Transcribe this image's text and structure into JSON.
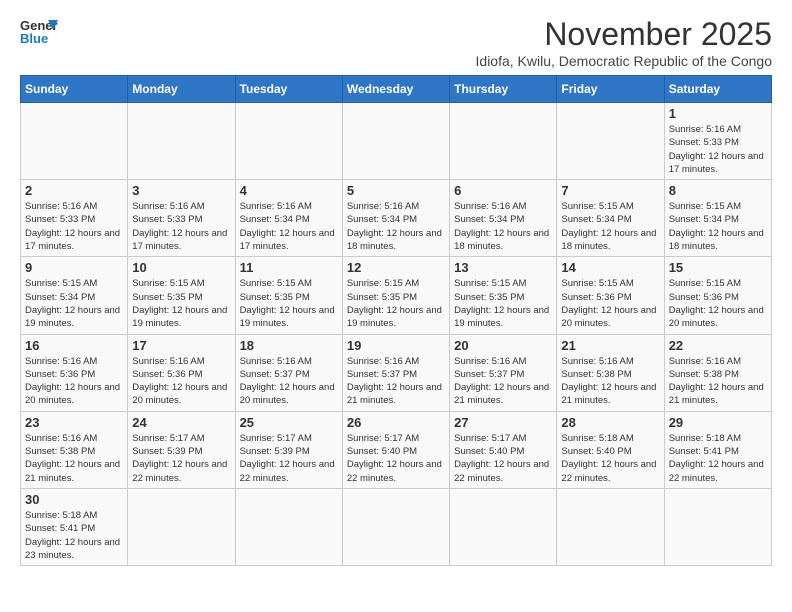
{
  "logo": {
    "line1": "General",
    "line2": "Blue"
  },
  "title": "November 2025",
  "subtitle": "Idiofa, Kwilu, Democratic Republic of the Congo",
  "days_of_week": [
    "Sunday",
    "Monday",
    "Tuesday",
    "Wednesday",
    "Thursday",
    "Friday",
    "Saturday"
  ],
  "weeks": [
    [
      {
        "day": "",
        "info": ""
      },
      {
        "day": "",
        "info": ""
      },
      {
        "day": "",
        "info": ""
      },
      {
        "day": "",
        "info": ""
      },
      {
        "day": "",
        "info": ""
      },
      {
        "day": "",
        "info": ""
      },
      {
        "day": "1",
        "info": "Sunrise: 5:16 AM\nSunset: 5:33 PM\nDaylight: 12 hours and 17 minutes."
      }
    ],
    [
      {
        "day": "2",
        "info": "Sunrise: 5:16 AM\nSunset: 5:33 PM\nDaylight: 12 hours and 17 minutes."
      },
      {
        "day": "3",
        "info": "Sunrise: 5:16 AM\nSunset: 5:33 PM\nDaylight: 12 hours and 17 minutes."
      },
      {
        "day": "4",
        "info": "Sunrise: 5:16 AM\nSunset: 5:34 PM\nDaylight: 12 hours and 17 minutes."
      },
      {
        "day": "5",
        "info": "Sunrise: 5:16 AM\nSunset: 5:34 PM\nDaylight: 12 hours and 18 minutes."
      },
      {
        "day": "6",
        "info": "Sunrise: 5:16 AM\nSunset: 5:34 PM\nDaylight: 12 hours and 18 minutes."
      },
      {
        "day": "7",
        "info": "Sunrise: 5:15 AM\nSunset: 5:34 PM\nDaylight: 12 hours and 18 minutes."
      },
      {
        "day": "8",
        "info": "Sunrise: 5:15 AM\nSunset: 5:34 PM\nDaylight: 12 hours and 18 minutes."
      }
    ],
    [
      {
        "day": "9",
        "info": "Sunrise: 5:15 AM\nSunset: 5:34 PM\nDaylight: 12 hours and 19 minutes."
      },
      {
        "day": "10",
        "info": "Sunrise: 5:15 AM\nSunset: 5:35 PM\nDaylight: 12 hours and 19 minutes."
      },
      {
        "day": "11",
        "info": "Sunrise: 5:15 AM\nSunset: 5:35 PM\nDaylight: 12 hours and 19 minutes."
      },
      {
        "day": "12",
        "info": "Sunrise: 5:15 AM\nSunset: 5:35 PM\nDaylight: 12 hours and 19 minutes."
      },
      {
        "day": "13",
        "info": "Sunrise: 5:15 AM\nSunset: 5:35 PM\nDaylight: 12 hours and 19 minutes."
      },
      {
        "day": "14",
        "info": "Sunrise: 5:15 AM\nSunset: 5:36 PM\nDaylight: 12 hours and 20 minutes."
      },
      {
        "day": "15",
        "info": "Sunrise: 5:15 AM\nSunset: 5:36 PM\nDaylight: 12 hours and 20 minutes."
      }
    ],
    [
      {
        "day": "16",
        "info": "Sunrise: 5:16 AM\nSunset: 5:36 PM\nDaylight: 12 hours and 20 minutes."
      },
      {
        "day": "17",
        "info": "Sunrise: 5:16 AM\nSunset: 5:36 PM\nDaylight: 12 hours and 20 minutes."
      },
      {
        "day": "18",
        "info": "Sunrise: 5:16 AM\nSunset: 5:37 PM\nDaylight: 12 hours and 20 minutes."
      },
      {
        "day": "19",
        "info": "Sunrise: 5:16 AM\nSunset: 5:37 PM\nDaylight: 12 hours and 21 minutes."
      },
      {
        "day": "20",
        "info": "Sunrise: 5:16 AM\nSunset: 5:37 PM\nDaylight: 12 hours and 21 minutes."
      },
      {
        "day": "21",
        "info": "Sunrise: 5:16 AM\nSunset: 5:38 PM\nDaylight: 12 hours and 21 minutes."
      },
      {
        "day": "22",
        "info": "Sunrise: 5:16 AM\nSunset: 5:38 PM\nDaylight: 12 hours and 21 minutes."
      }
    ],
    [
      {
        "day": "23",
        "info": "Sunrise: 5:16 AM\nSunset: 5:38 PM\nDaylight: 12 hours and 21 minutes."
      },
      {
        "day": "24",
        "info": "Sunrise: 5:17 AM\nSunset: 5:39 PM\nDaylight: 12 hours and 22 minutes."
      },
      {
        "day": "25",
        "info": "Sunrise: 5:17 AM\nSunset: 5:39 PM\nDaylight: 12 hours and 22 minutes."
      },
      {
        "day": "26",
        "info": "Sunrise: 5:17 AM\nSunset: 5:40 PM\nDaylight: 12 hours and 22 minutes."
      },
      {
        "day": "27",
        "info": "Sunrise: 5:17 AM\nSunset: 5:40 PM\nDaylight: 12 hours and 22 minutes."
      },
      {
        "day": "28",
        "info": "Sunrise: 5:18 AM\nSunset: 5:40 PM\nDaylight: 12 hours and 22 minutes."
      },
      {
        "day": "29",
        "info": "Sunrise: 5:18 AM\nSunset: 5:41 PM\nDaylight: 12 hours and 22 minutes."
      }
    ],
    [
      {
        "day": "30",
        "info": "Sunrise: 5:18 AM\nSunset: 5:41 PM\nDaylight: 12 hours and 23 minutes."
      },
      {
        "day": "",
        "info": ""
      },
      {
        "day": "",
        "info": ""
      },
      {
        "day": "",
        "info": ""
      },
      {
        "day": "",
        "info": ""
      },
      {
        "day": "",
        "info": ""
      },
      {
        "day": "",
        "info": ""
      }
    ]
  ]
}
